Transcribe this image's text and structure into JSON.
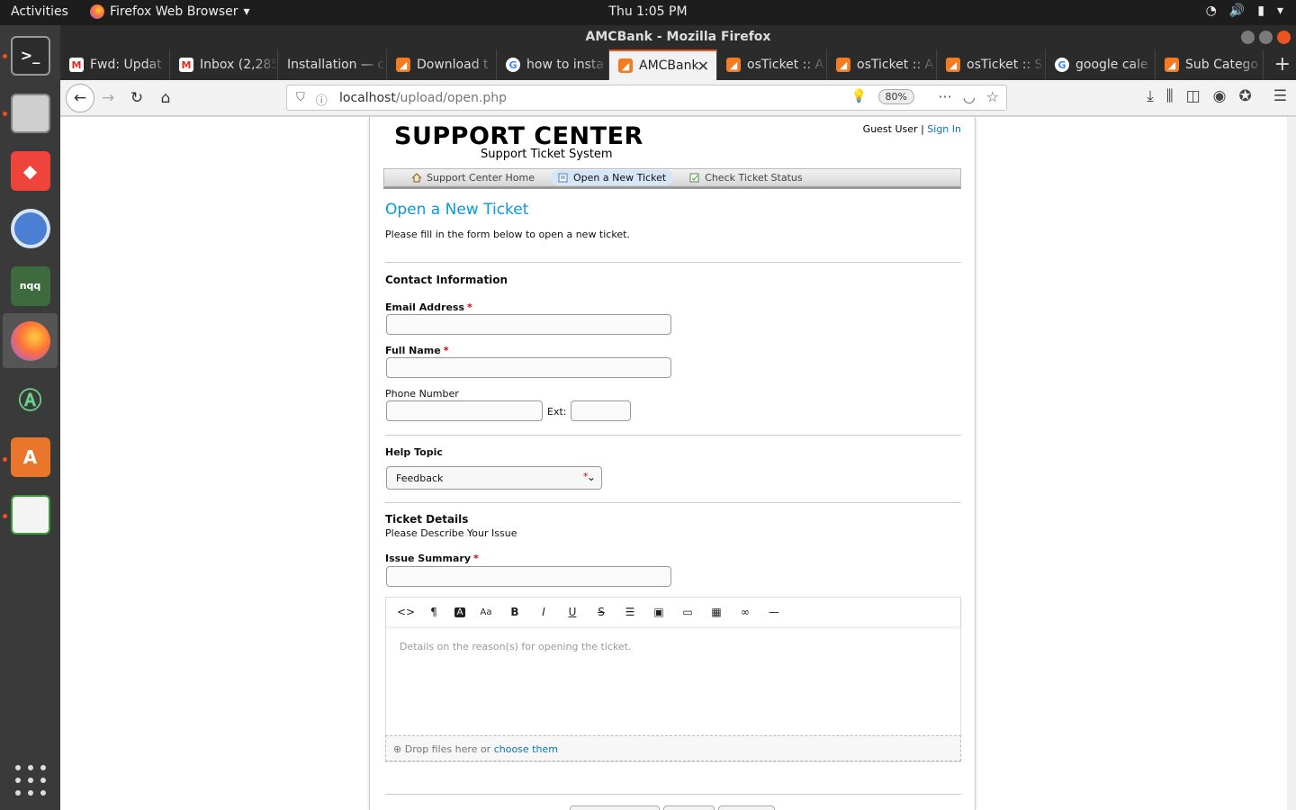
{
  "system": {
    "activities": "Activities",
    "app_menu": "Firefox Web Browser",
    "clock": "Thu  1:05 PM"
  },
  "window": {
    "title": "AMCBank - Mozilla Firefox"
  },
  "tabs": [
    {
      "label": "Fwd: Updat",
      "icon": "gmail-icon"
    },
    {
      "label": "Inbox (2,285",
      "icon": "gmail-icon"
    },
    {
      "label": "Installation — c",
      "icon": "none"
    },
    {
      "label": "Download t",
      "icon": "osticket-icon"
    },
    {
      "label": "how to insta",
      "icon": "google-icon"
    },
    {
      "label": "AMCBank",
      "icon": "osticket-icon",
      "active": true
    },
    {
      "label": "osTicket :: A",
      "icon": "osticket-icon"
    },
    {
      "label": "osTicket :: A",
      "icon": "osticket-icon"
    },
    {
      "label": "osTicket :: S",
      "icon": "osticket-icon"
    },
    {
      "label": "google cale",
      "icon": "google-icon"
    },
    {
      "label": "Sub Catego",
      "icon": "osticket-icon"
    }
  ],
  "urlbar": {
    "host": "localhost",
    "path": "/upload/open.php",
    "zoom": "80%"
  },
  "page": {
    "logo_title": "SUPPORT CENTER",
    "logo_subtitle": "Support Ticket System",
    "guest_user": "Guest User",
    "separator": "|",
    "sign_in": "Sign In",
    "nav": {
      "home": "Support Center Home",
      "open": "Open a New Ticket",
      "status": "Check Ticket Status"
    },
    "title": "Open a New Ticket",
    "intro": "Please fill in the form below to open a new ticket.",
    "contact_heading": "Contact Information",
    "email_label": "Email Address",
    "fullname_label": "Full Name",
    "phone_label": "Phone Number",
    "ext_label": "Ext:",
    "required_mark": "*",
    "help_topic_heading": "Help Topic",
    "help_topic_value": "Feedback",
    "ticket_details_heading": "Ticket Details",
    "ticket_details_sub": "Please Describe Your Issue",
    "issue_summary_label": "Issue Summary",
    "editor_placeholder": "Details on the reason(s) for opening the ticket.",
    "drop_text": "Drop files here or",
    "drop_link": "choose them"
  },
  "colors": {
    "accent_orange": "#e95420",
    "link_blue": "#0a73b7",
    "title_blue": "#0a99d6"
  }
}
